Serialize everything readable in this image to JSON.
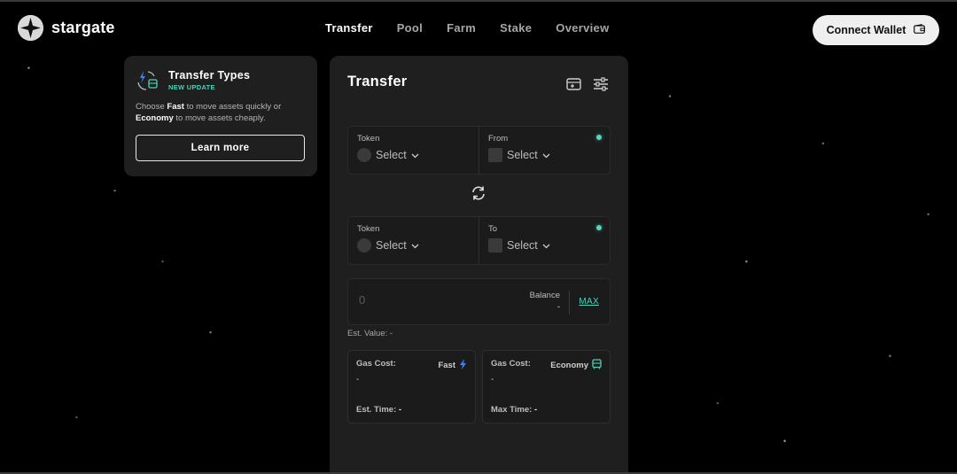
{
  "brand": {
    "name": "stargate"
  },
  "nav": [
    {
      "label": "Transfer",
      "active": true
    },
    {
      "label": "Pool"
    },
    {
      "label": "Farm"
    },
    {
      "label": "Stake"
    },
    {
      "label": "Overview"
    }
  ],
  "connect": {
    "label": "Connect Wallet",
    "icon": "wallet-icon"
  },
  "info": {
    "title": "Transfer Types",
    "badge": "NEW UPDATE",
    "desc_1": "Choose ",
    "desc_fast": "Fast",
    "desc_2": " to move assets quickly or ",
    "desc_economy": "Economy",
    "desc_3": " to move assets cheaply.",
    "button": "Learn more"
  },
  "transfer": {
    "title": "Transfer",
    "source": {
      "token_label": "Token",
      "token_value": "Select",
      "chain_label": "From",
      "chain_value": "Select"
    },
    "dest": {
      "token_label": "Token",
      "token_value": "Select",
      "chain_label": "To",
      "chain_value": "Select"
    },
    "amount": {
      "placeholder": "0"
    },
    "balance": {
      "label": "Balance",
      "value": "-"
    },
    "max": "MAX",
    "est_value": "Est. Value: -",
    "fast": {
      "gas_label": "Gas Cost:",
      "gas_value": "-",
      "mode": "Fast",
      "time_label": "Est. Time:",
      "time_value": "-"
    },
    "economy": {
      "gas_label": "Gas Cost:",
      "gas_value": "-",
      "mode": "Economy",
      "time_label": "Max Time:",
      "time_value": "-"
    }
  },
  "colors": {
    "accent": "#4fd1b8",
    "fast_icon": "#3b82f6",
    "economy_icon": "#4fd1b8",
    "panel": "#1f1f1f"
  }
}
